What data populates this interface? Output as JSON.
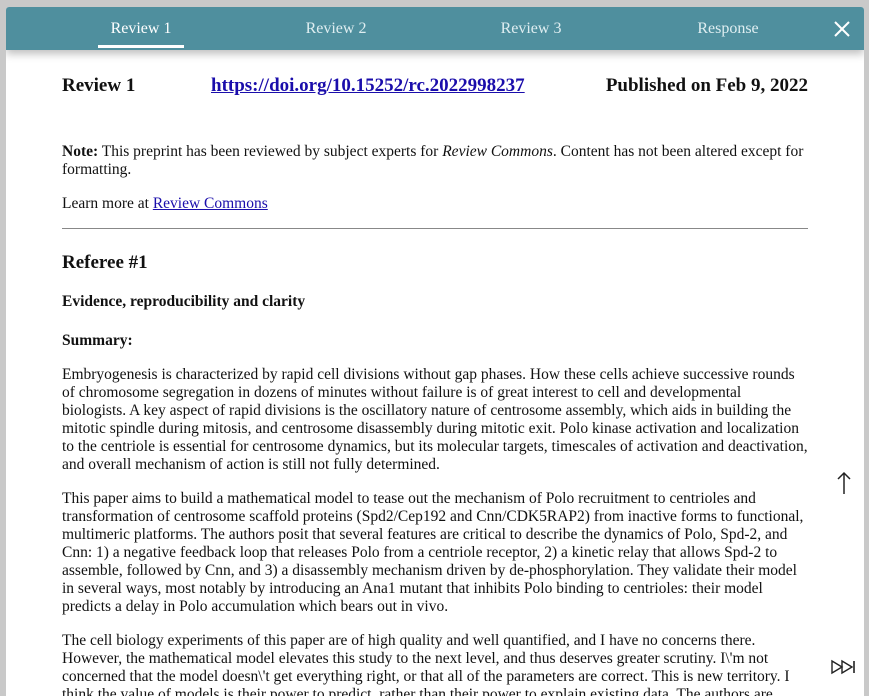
{
  "tabs": [
    {
      "label": "Review 1"
    },
    {
      "label": "Review 2"
    },
    {
      "label": "Review 3"
    },
    {
      "label": "Response"
    }
  ],
  "header": {
    "title": "Review 1",
    "doi": "https://doi.org/10.15252/rc.2022998237",
    "published": "Published on Feb 9, 2022"
  },
  "note": {
    "label": "Note:",
    "text_before": " This preprint has been reviewed by subject experts for ",
    "source_italic": "Review Commons",
    "text_after": ". Content has not been altered except for formatting."
  },
  "learn": {
    "text": "Learn more at ",
    "link": "Review Commons"
  },
  "referee": "Referee #1",
  "section_heading": "Evidence, reproducibility and clarity",
  "summary_heading": "Summary:",
  "paragraphs": [
    "Embryogenesis is characterized by rapid cell divisions without gap phases. How these cells achieve successive rounds of chromosome segregation in dozens of minutes without failure is of great interest to cell and developmental biologists. A key aspect of rapid divisions is the oscillatory nature of centrosome assembly, which aids in building the mitotic spindle during mitosis, and centrosome disassembly during mitotic exit. Polo kinase activation and localization to the centriole is essential for centrosome dynamics, but its molecular targets, timescales of activation and deactivation, and overall mechanism of action is still not fully determined.",
    "This paper aims to build a mathematical model to tease out the mechanism of Polo recruitment to centrioles and transformation of centrosome scaffold proteins (Spd2/Cep192 and Cnn/CDK5RAP2) from inactive forms to functional, multimeric platforms. The authors posit that several features are critical to describe the dynamics of Polo, Spd-2, and Cnn: 1) a negative feedback loop that releases Polo from a centriole receptor, 2) a kinetic relay that allows Spd-2 to assemble, followed by Cnn, and 3) a disassembly mechanism driven by de-phosphorylation. They validate their model in several ways, most notably by introducing an Ana1 mutant that inhibits Polo binding to centrioles: their model predicts a delay in Polo accumulation which bears out in vivo.",
    "The cell biology experiments of this paper are of high quality and well quantified, and I have no concerns there. However, the mathematical model elevates this study to the next level, and thus deserves greater scrutiny. I\\'m not concerned that the model doesn\\'t get everything right, or that all of the parameters are correct. This is new territory. I think the value of models is their power to predict, rather than their power to explain existing data. The authors are"
  ],
  "icons": {
    "close": "close-icon",
    "scroll_top": "arrow-up-icon",
    "skip": "skip-forward-icon"
  },
  "colors": {
    "tabbar": "#4f8f9e",
    "link": "#1a0dab"
  }
}
